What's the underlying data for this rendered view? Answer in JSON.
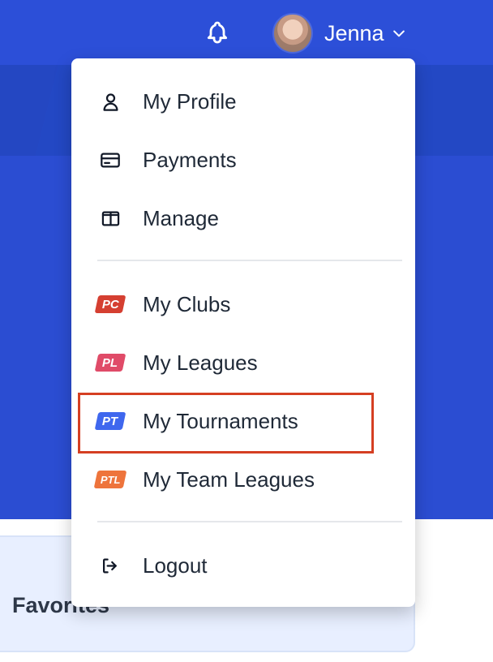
{
  "header": {
    "user_name": "Jenna",
    "icons": [
      "bell-icon",
      "chevron-down-icon"
    ]
  },
  "main": {
    "favorites_title": "Favorites"
  },
  "dropdown": {
    "items": [
      {
        "label": "My Profile",
        "icon": "user-icon"
      },
      {
        "label": "Payments",
        "icon": "credit-card-icon"
      },
      {
        "label": "Manage",
        "icon": "layout-icon"
      },
      {
        "label": "My Clubs",
        "icon": "pc-badge-icon",
        "badge": "PC",
        "badge_color": "#d53f31"
      },
      {
        "label": "My Leagues",
        "icon": "pl-badge-icon",
        "badge": "PL",
        "badge_color": "#e04b68"
      },
      {
        "label": "My Tournaments",
        "icon": "pt-badge-icon",
        "badge": "PT",
        "badge_color": "#3f67ee"
      },
      {
        "label": "My Team Leagues",
        "icon": "ptl-badge-icon",
        "badge": "PTL",
        "badge_color": "#ee743c"
      },
      {
        "label": "Logout",
        "icon": "logout-icon"
      }
    ]
  },
  "colors": {
    "header_blue": "#2c4fd8",
    "highlight_red": "#d53f22"
  }
}
